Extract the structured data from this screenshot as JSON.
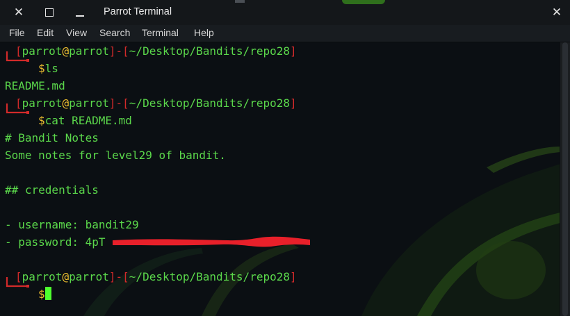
{
  "window": {
    "title": "Parrot Terminal",
    "close_glyph": "✕",
    "icons": [
      "close-icon",
      "maximize-icon",
      "minimize-icon"
    ]
  },
  "menu": [
    "File",
    "Edit",
    "View",
    "Search",
    "Terminal",
    "Help"
  ],
  "prompt": {
    "bracket_open": "[",
    "user": "parrot",
    "at": "@",
    "host": "parrot",
    "bracket_close": "]",
    "dash": "-",
    "path_open": "[",
    "path": "~/Desktop/Bandits/repo28",
    "path_close": "]",
    "dollar": "$"
  },
  "output": {
    "cmd1": "ls",
    "out1": "README.md",
    "cmd2": "cat README.md",
    "lines": [
      "# Bandit Notes",
      "Some notes for level29 of bandit.",
      "## credentials",
      "- username: bandit29",
      "- password: 4pT"
    ]
  },
  "colors": {
    "prompt_red": "#d22a2a",
    "prompt_green": "#5bd84b",
    "prompt_yellow": "#f0c030",
    "redaction": "#e8202a",
    "cursor": "#4dff2e"
  }
}
